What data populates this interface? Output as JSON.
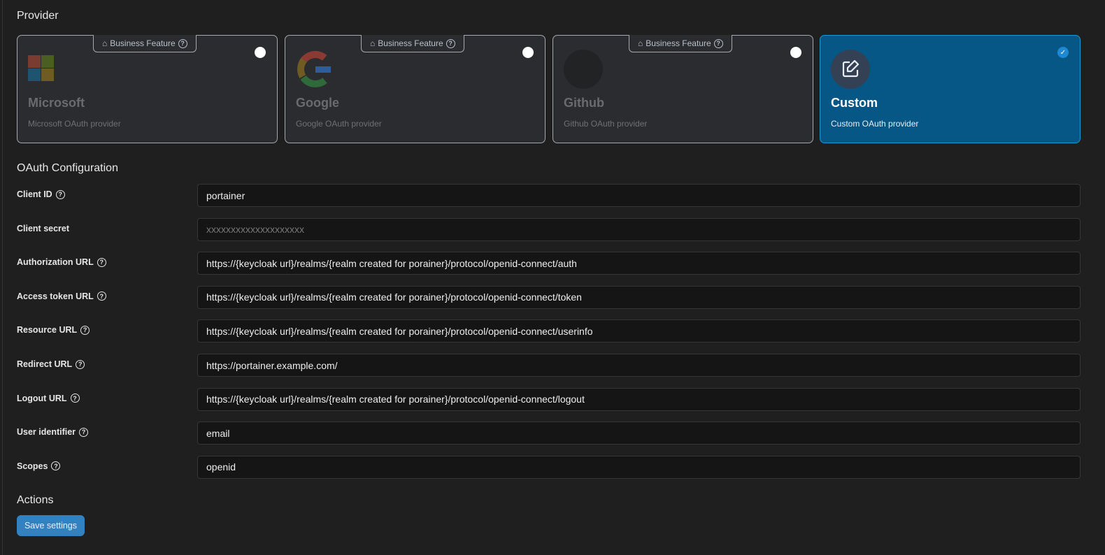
{
  "provider": {
    "heading": "Provider",
    "badge": "Business Feature",
    "cards": [
      {
        "title": "Microsoft",
        "desc": "Microsoft OAuth provider",
        "selected": false
      },
      {
        "title": "Google",
        "desc": "Google OAuth provider",
        "selected": false
      },
      {
        "title": "Github",
        "desc": "Github OAuth provider",
        "selected": false
      },
      {
        "title": "Custom",
        "desc": "Custom OAuth provider",
        "selected": true
      }
    ]
  },
  "oauth": {
    "heading": "OAuth Configuration",
    "fields": [
      {
        "label": "Client ID",
        "value": "portainer",
        "placeholder": "",
        "help": true
      },
      {
        "label": "Client secret",
        "value": "",
        "placeholder": "xxxxxxxxxxxxxxxxxxxx",
        "help": false
      },
      {
        "label": "Authorization URL",
        "value": "https://{keycloak url}/realms/{realm created for porainer}/protocol/openid-connect/auth",
        "placeholder": "",
        "help": true
      },
      {
        "label": "Access token URL",
        "value": "https://{keycloak url}/realms/{realm created for porainer}/protocol/openid-connect/token",
        "placeholder": "",
        "help": true
      },
      {
        "label": "Resource URL",
        "value": "https://{keycloak url}/realms/{realm created for porainer}/protocol/openid-connect/userinfo",
        "placeholder": "",
        "help": true
      },
      {
        "label": "Redirect URL",
        "value": "https://portainer.example.com/",
        "placeholder": "",
        "help": true
      },
      {
        "label": "Logout URL",
        "value": "https://{keycloak url}/realms/{realm created for porainer}/protocol/openid-connect/logout",
        "placeholder": "",
        "help": true
      },
      {
        "label": "User identifier",
        "value": "email",
        "placeholder": "",
        "help": true
      },
      {
        "label": "Scopes",
        "value": "openid",
        "placeholder": "",
        "help": true
      }
    ]
  },
  "actions": {
    "heading": "Actions",
    "save_label": "Save settings"
  }
}
